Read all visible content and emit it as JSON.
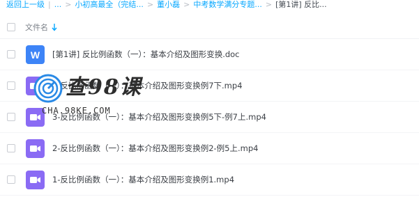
{
  "breadcrumb": {
    "back": "返回上一级",
    "sep": "|",
    "ellipsis": "...",
    "items": [
      "小初高最全（完结...",
      "董小磊",
      "中考数学满分专题...",
      "[第1讲] 反比..."
    ]
  },
  "header": {
    "column_filename": "文件名",
    "sort_icon": "arrow-down-icon"
  },
  "files": [
    {
      "name": "[第1讲] 反比例函数（一）：基本介绍及图形变换.doc",
      "type": "word",
      "icon_label": "W"
    },
    {
      "name": "4-反比例函数（一）：基本介绍及图形变换例7下.mp4",
      "type": "video"
    },
    {
      "name": "3-反比例函数（一）：基本介绍及图形变换例5下-例7上.mp4",
      "type": "video"
    },
    {
      "name": "2-反比例函数（一）：基本介绍及图形变换例2-例5上.mp4",
      "type": "video"
    },
    {
      "name": "1-反比例函数（一）：基本介绍及图形变换例1.mp4",
      "type": "video"
    }
  ],
  "watermark": {
    "title": "查98课",
    "url": "CHA.98KE.COM"
  },
  "colors": {
    "link": "#06a7ff",
    "word": "#3d84f7",
    "video": "#8a6bf4"
  }
}
